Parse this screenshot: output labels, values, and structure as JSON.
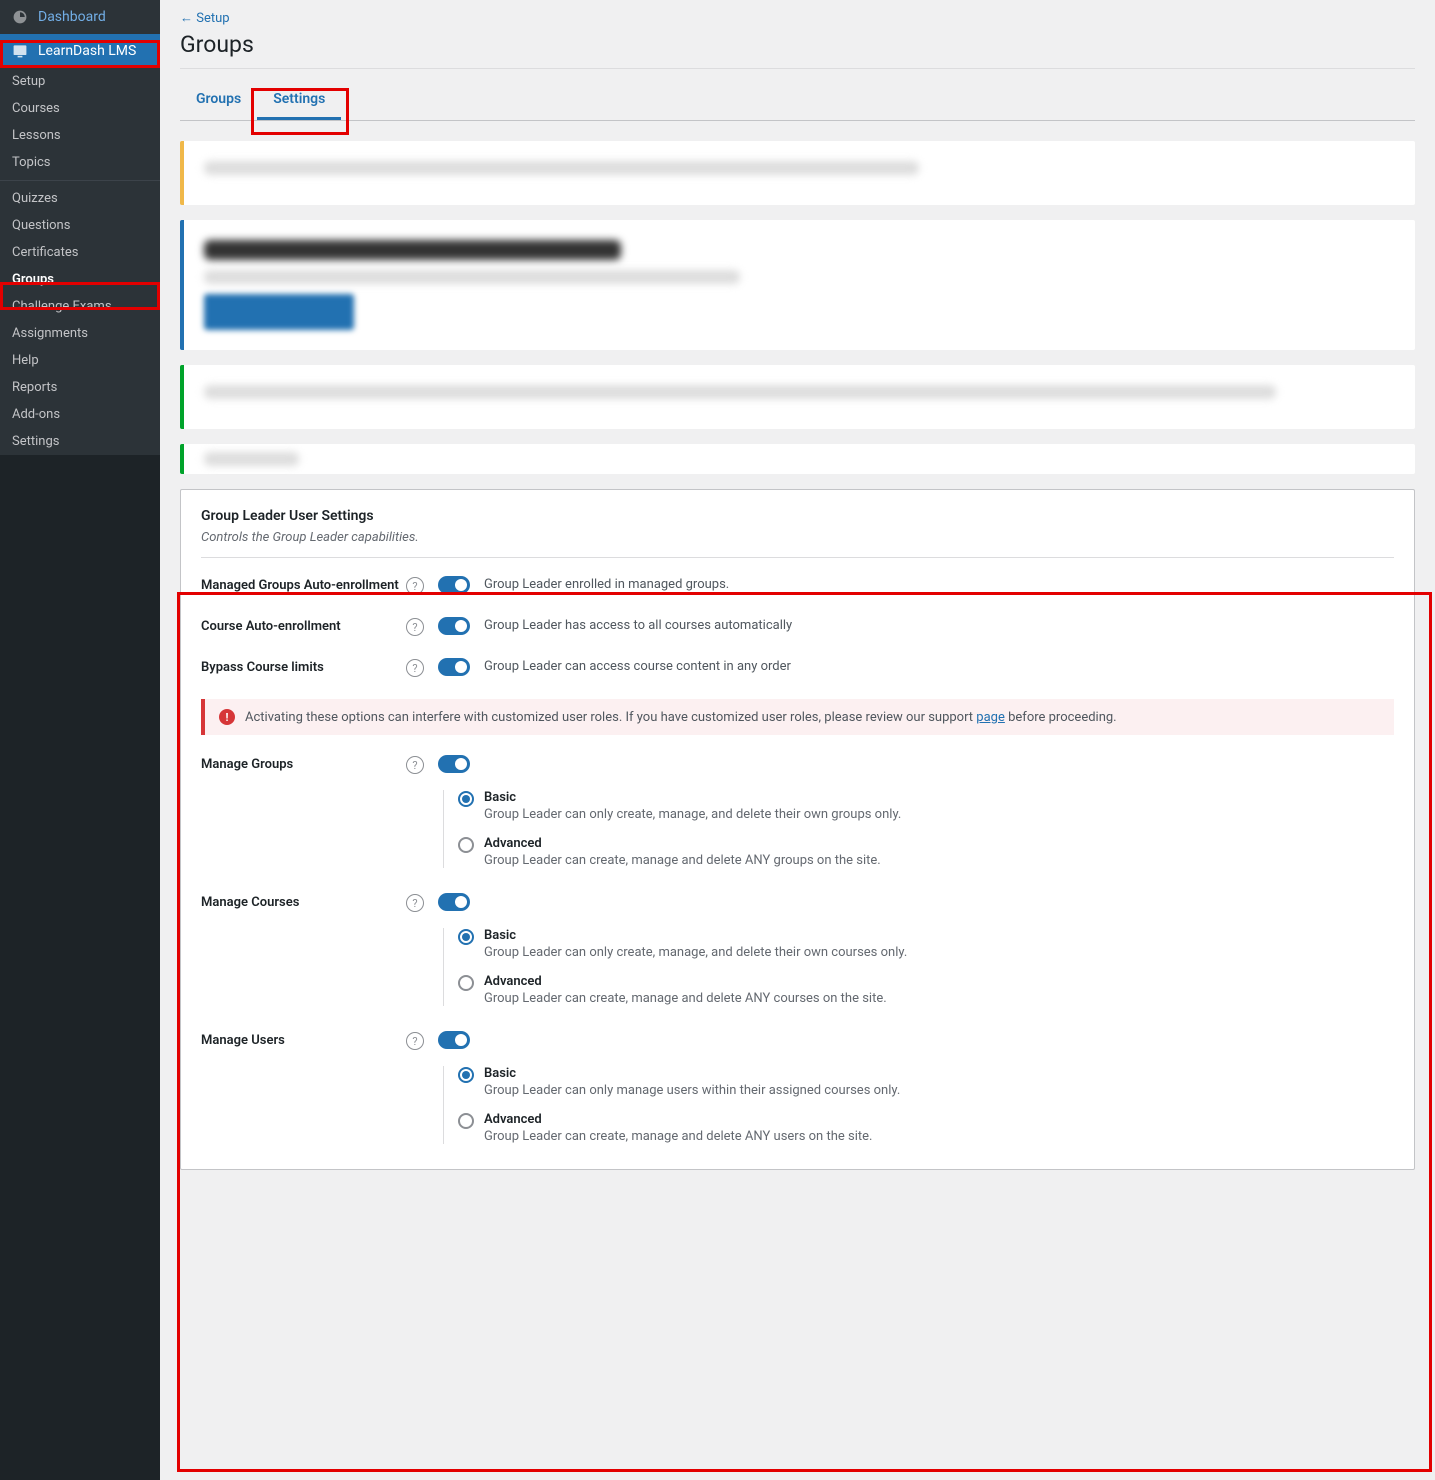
{
  "sidebar": {
    "dashboard": "Dashboard",
    "learndash": "LearnDash LMS",
    "sub": [
      "Setup",
      "Courses",
      "Lessons",
      "Topics",
      "Quizzes",
      "Questions",
      "Certificates",
      "Groups",
      "Challenge Exams",
      "Assignments",
      "Help",
      "Reports",
      "Add-ons",
      "Settings"
    ]
  },
  "header": {
    "backlink": "Setup",
    "title": "Groups"
  },
  "tabs": {
    "groups": "Groups",
    "settings": "Settings"
  },
  "panel": {
    "title": "Group Leader User Settings",
    "desc": "Controls the Group Leader capabilities."
  },
  "settings": {
    "autoenroll_groups": {
      "label": "Managed Groups Auto-enrollment",
      "desc": "Group Leader enrolled in managed groups."
    },
    "autoenroll_courses": {
      "label": "Course Auto-enrollment",
      "desc": "Group Leader has access to all courses automatically"
    },
    "bypass": {
      "label": "Bypass Course limits",
      "desc": "Group Leader can access course content in any order"
    },
    "warning_pre": "Activating these options can interfere with customized user roles. If you have customized user roles, please review our support ",
    "warning_link": "page",
    "warning_post": " before proceeding.",
    "manage_groups": {
      "label": "Manage Groups",
      "basic": {
        "t": "Basic",
        "d": "Group Leader can only create, manage, and delete their own groups only."
      },
      "advanced": {
        "t": "Advanced",
        "d": "Group Leader can create, manage and delete ANY groups on the site."
      }
    },
    "manage_courses": {
      "label": "Manage Courses",
      "basic": {
        "t": "Basic",
        "d": "Group Leader can only create, manage, and delete their own courses only."
      },
      "advanced": {
        "t": "Advanced",
        "d": "Group Leader can create, manage and delete ANY courses on the site."
      }
    },
    "manage_users": {
      "label": "Manage Users",
      "basic": {
        "t": "Basic",
        "d": "Group Leader can only manage users within their assigned courses only."
      },
      "advanced": {
        "t": "Advanced",
        "d": "Group Leader can create, manage and delete ANY users on the site."
      }
    }
  }
}
